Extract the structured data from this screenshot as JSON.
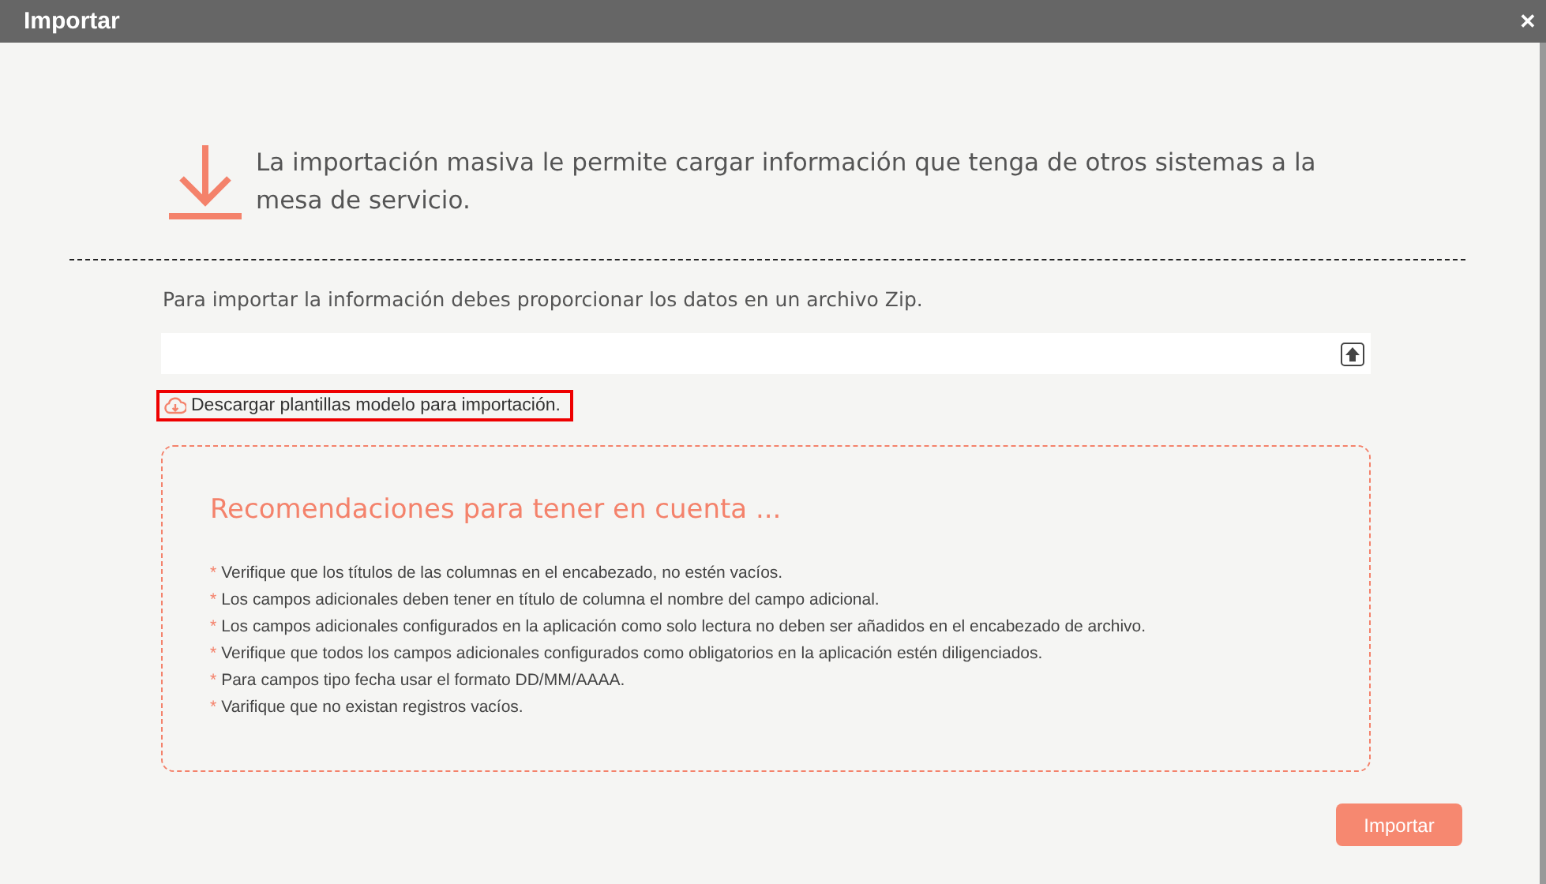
{
  "window": {
    "title": "Importar",
    "close": "✕"
  },
  "intro": "La importación masiva le permite cargar información que tenga de otros sistemas a la mesa de servicio.",
  "instructions": "Para importar la información debes proporcionar los datos en un archivo Zip.",
  "download_link": "Descargar plantillas modelo para importación.",
  "recommendations": {
    "title": "Recomendaciones para tener en cuenta ...",
    "bullet": "*",
    "items": [
      "Verifique que los títulos de las columnas en el encabezado, no estén vacíos.",
      "Los campos adicionales deben tener en título de columna el nombre del campo adicional.",
      "Los campos adicionales configurados en la aplicación como solo lectura no deben ser añadidos en el encabezado de archivo.",
      "Verifique que todos los campos adicionales configurados como obligatorios en la aplicación estén diligenciados.",
      "Para campos tipo fecha usar el formato DD/MM/AAAA.",
      "Varifique que no existan registros vacíos."
    ]
  },
  "buttons": [
    "Importar"
  ]
}
